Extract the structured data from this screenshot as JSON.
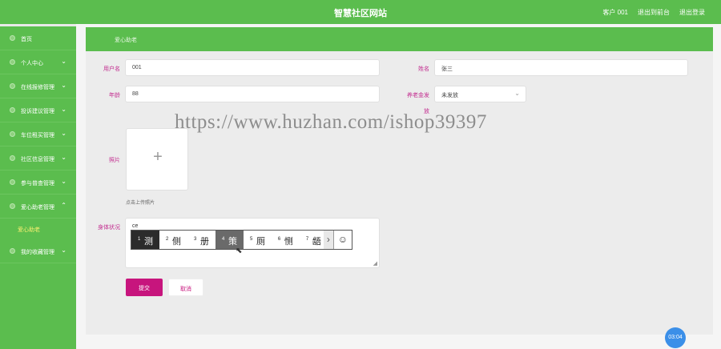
{
  "header": {
    "title": "智慧社区网站",
    "links": [
      "客户 001",
      "退出到前台",
      "退出登录"
    ]
  },
  "sidebar": {
    "items": [
      {
        "label": "首页",
        "chevron": ""
      },
      {
        "label": "个人中心",
        "chevron": "⌄"
      },
      {
        "label": "在线报修管理",
        "chevron": "⌄"
      },
      {
        "label": "投诉建议管理",
        "chevron": "⌄"
      },
      {
        "label": "车位租买管理",
        "chevron": "⌄"
      },
      {
        "label": "社区信息管理",
        "chevron": "⌄"
      },
      {
        "label": "参与普查管理",
        "chevron": "⌄"
      },
      {
        "label": "爱心助老管理",
        "chevron": "⌃"
      },
      {
        "label": "爱心助老",
        "chevron": ""
      },
      {
        "label": "我的收藏管理",
        "chevron": "⌄"
      }
    ]
  },
  "breadcrumb": "爱心助老",
  "form": {
    "username_label": "用户名",
    "username_value": "001",
    "name_label": "姓名",
    "name_value": "张三",
    "age_label": "年龄",
    "age_value": "88",
    "pension_label": "养老金发",
    "pension_extra": "放",
    "pension_value": "未发放",
    "photo_label": "照片",
    "upload_hint": "点击上传照片",
    "health_label": "身体状况",
    "health_typed": "ce",
    "submit": "提交",
    "cancel": "取消"
  },
  "ime": {
    "candidates": [
      {
        "num": "1",
        "char": "测"
      },
      {
        "num": "2",
        "char": "侧"
      },
      {
        "num": "3",
        "char": "册"
      },
      {
        "num": "4",
        "char": "策"
      },
      {
        "num": "5",
        "char": "厕"
      },
      {
        "num": "6",
        "char": "恻"
      },
      {
        "num": "7",
        "char": "龉"
      }
    ],
    "more": "›",
    "emoji": "☺"
  },
  "timer": "03:04",
  "watermark": "https://www.huzhan.com/ishop39397",
  "colors": {
    "green": "#5bbd4e",
    "magenta": "#c7157d",
    "blue": "#3b8fe8"
  }
}
